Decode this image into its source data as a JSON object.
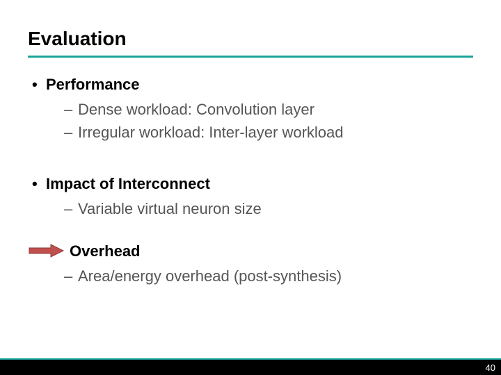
{
  "title": "Evaluation",
  "sections": [
    {
      "heading": "Performance",
      "items": [
        "Dense workload: Convolution layer",
        "Irregular workload: Inter-layer workload"
      ]
    },
    {
      "heading": "Impact of Interconnect",
      "items": [
        "Variable virtual neuron size"
      ]
    },
    {
      "heading": "Overhead",
      "items": [
        "Area/energy overhead (post-synthesis)"
      ]
    }
  ],
  "page_number": "40",
  "colors": {
    "accent": "#1aa39a",
    "arrow_fill": "#c0504d",
    "arrow_stroke": "#8b3a37"
  }
}
